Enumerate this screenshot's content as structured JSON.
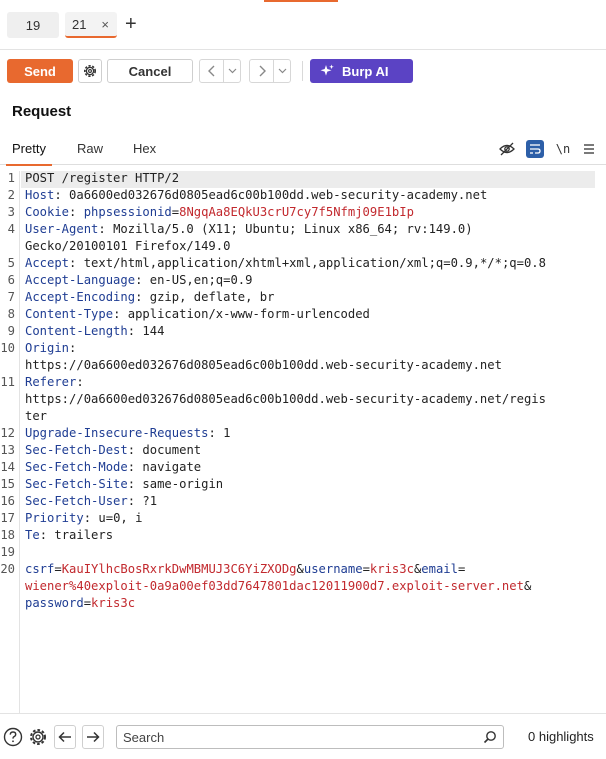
{
  "tabs": [
    {
      "label": "19"
    },
    {
      "label": "21",
      "close": "×"
    }
  ],
  "tab_add": "+",
  "toolbar": {
    "send_label": "Send",
    "cancel_label": "Cancel",
    "ai_label": "Burp AI"
  },
  "request": {
    "title": "Request",
    "view_tabs": [
      "Pretty",
      "Raw",
      "Hex"
    ],
    "newline_toggle": "\\n"
  },
  "colors": {
    "accent": "#e8692f",
    "ai": "#5b43c4",
    "header_name": "#1f3d93",
    "param_value": "#c2292e"
  },
  "editor": {
    "line_numbers": [
      "1",
      "2",
      "3",
      "4",
      "5",
      "6",
      "7",
      "8",
      "9",
      "10",
      "11",
      "12",
      "13",
      "14",
      "15",
      "16",
      "17",
      "18",
      "19",
      "20"
    ],
    "request_line": "POST /register HTTP/2",
    "headers": [
      {
        "name": "Host",
        "value": "0a6600ed032676d0805ead6c00b100dd.web-security-academy.net"
      },
      {
        "name": "Cookie",
        "cookie_name": "phpsessionid",
        "cookie_value": "8NgqAa8EQkU3crU7cy7f5Nfmj09E1bIp"
      },
      {
        "name": "User-Agent",
        "value": "Mozilla/5.0 (X11; Ubuntu; Linux x86_64; rv:149.0)",
        "value_cont": "Gecko/20100101 Firefox/149.0"
      },
      {
        "name": "Accept",
        "value": "text/html,application/xhtml+xml,application/xml;q=0.9,*/*;q=0.8"
      },
      {
        "name": "Accept-Language",
        "value": "en-US,en;q=0.9"
      },
      {
        "name": "Accept-Encoding",
        "value": "gzip, deflate, br"
      },
      {
        "name": "Content-Type",
        "value": "application/x-www-form-urlencoded"
      },
      {
        "name": "Content-Length",
        "value": "144"
      },
      {
        "name": "Origin",
        "value_cont": "https://0a6600ed032676d0805ead6c00b100dd.web-security-academy.net"
      },
      {
        "name": "Referer",
        "value_cont": "https://0a6600ed032676d0805ead6c00b100dd.web-security-academy.net/regis",
        "value_cont2": "ter"
      },
      {
        "name": "Upgrade-Insecure-Requests",
        "value": "1"
      },
      {
        "name": "Sec-Fetch-Dest",
        "value": "document"
      },
      {
        "name": "Sec-Fetch-Mode",
        "value": "navigate"
      },
      {
        "name": "Sec-Fetch-Site",
        "value": "same-origin"
      },
      {
        "name": "Sec-Fetch-User",
        "value": "?1"
      },
      {
        "name": "Priority",
        "value": "u=0, i"
      },
      {
        "name": "Te",
        "value": "trailers"
      }
    ],
    "body": {
      "csrf_key": "csrf",
      "csrf_value": "KauIYlhcBosRxrkDwMBMUJ3C6YiZXODg",
      "username_key": "username",
      "username_value": "kris3c",
      "email_key": "email",
      "email_value": "wiener%40exploit-0a9a00ef03dd7647801dac12011900d7.exploit-server.net",
      "password_key": "password",
      "password_value": "kris3c"
    }
  },
  "footer": {
    "search_placeholder": "Search",
    "highlights": "0 highlights"
  }
}
